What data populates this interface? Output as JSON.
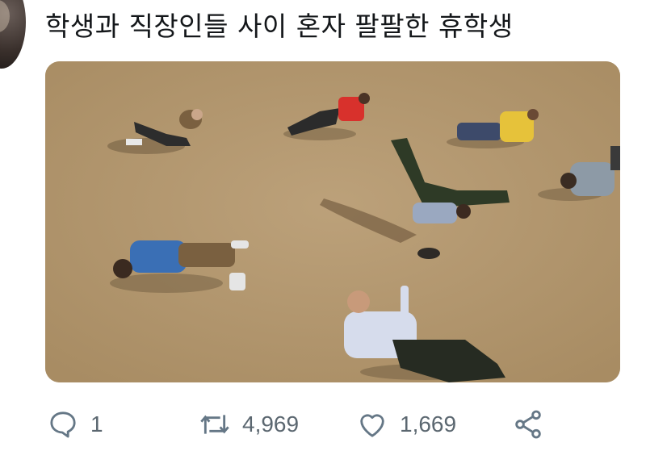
{
  "tweet": {
    "text": "학생과 직장인들 사이 혼자 팔팔한 휴학생"
  },
  "actions": {
    "reply_count": "1",
    "retweet_count": "4,969",
    "like_count": "1,669"
  },
  "icons": {
    "reply": "speech-bubble-icon",
    "retweet": "retweet-arrows-icon",
    "like": "heart-icon",
    "share": "share-nodes-icon"
  },
  "colors": {
    "text": "#14171a",
    "icon": "#657786",
    "ground": "#b59a72"
  }
}
